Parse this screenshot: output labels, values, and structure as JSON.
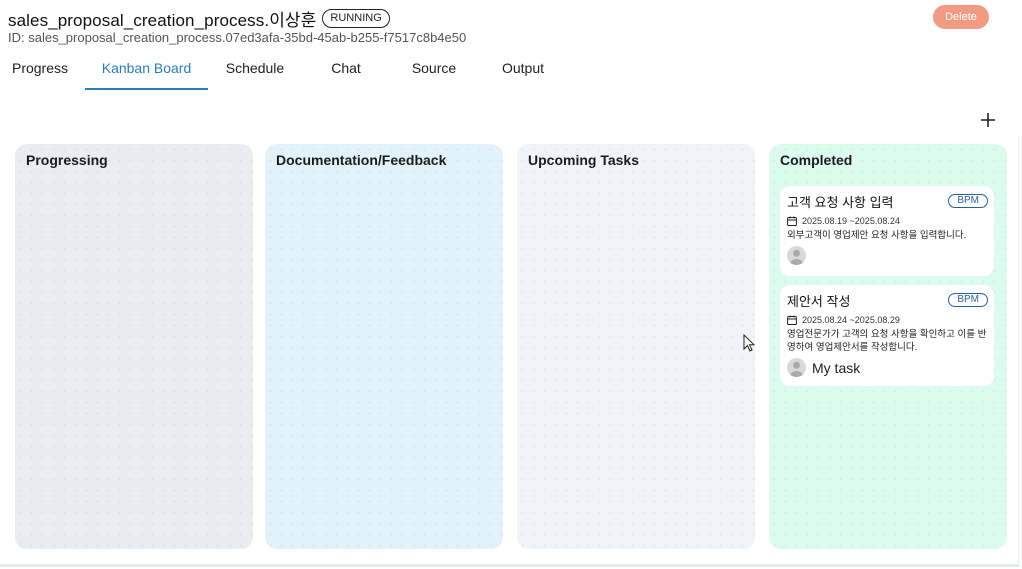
{
  "header": {
    "title": "sales_proposal_creation_process.이상훈",
    "status": "RUNNING",
    "id_text": "ID: sales_proposal_creation_process.07ed3afa-35bd-45ab-b255-f7517c8b4e50",
    "delete_label": "Delete"
  },
  "tabs": [
    {
      "label": "Progress",
      "active": false
    },
    {
      "label": "Kanban Board",
      "active": true
    },
    {
      "label": "Schedule",
      "active": false
    },
    {
      "label": "Chat",
      "active": false
    },
    {
      "label": "Source",
      "active": false
    },
    {
      "label": "Output",
      "active": false
    }
  ],
  "toolbar": {
    "add_icon": "plus-icon"
  },
  "board": {
    "columns": [
      {
        "title": "Progressing",
        "color": "#e9ecf0",
        "cards": []
      },
      {
        "title": "Documentation/Feedback",
        "color": "#e1f3f8",
        "cards": []
      },
      {
        "title": "Upcoming Tasks",
        "color": "#f0f4f8",
        "cards": []
      },
      {
        "title": "Completed",
        "color": "#dbfbef",
        "cards": [
          {
            "title": "고객 요청 사항 입력",
            "tag": "BPM",
            "dates": "2025.08.19 ~2025.08.24",
            "description": "외부고객이 영업제안 요청 사항을 입력합니다.",
            "assignee": ""
          },
          {
            "title": "제안서 작성",
            "tag": "BPM",
            "dates": "2025.08.24 ~2025.08.29",
            "description": "영업전문가가 고객의 요청 사항을 확인하고 이를 반영하여 영업제안서를 작성합니다.",
            "assignee": "My task"
          }
        ]
      }
    ]
  },
  "colors": {
    "accent": "#2a7fc0",
    "delete": "#f39a83",
    "tag": "#2a5f9e"
  }
}
